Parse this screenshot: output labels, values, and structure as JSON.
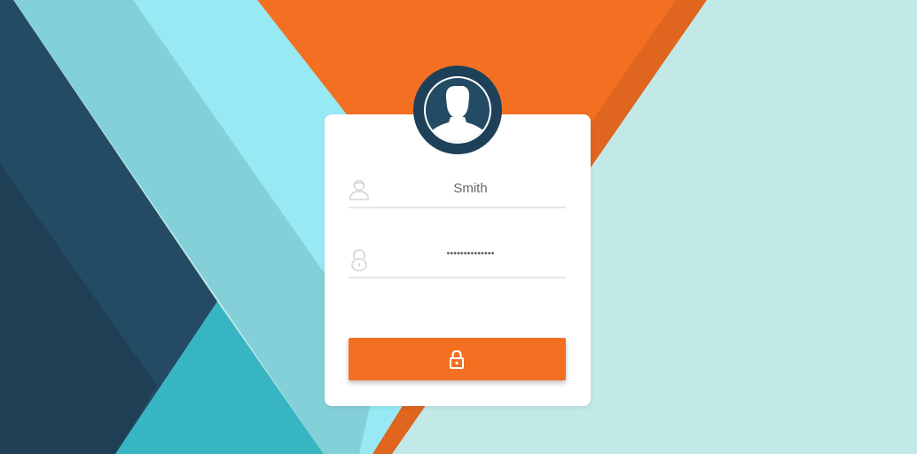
{
  "login": {
    "username_value": "Smith",
    "password_value": "••••••••••••••",
    "icons": {
      "avatar": "user-silhouette-icon",
      "username": "user-outline-icon",
      "password": "padlock-outline-icon",
      "submit": "padlock-icon"
    }
  },
  "colors": {
    "accent": "#f37022",
    "avatar": "#1e4159",
    "background": "#c2e9e8"
  }
}
